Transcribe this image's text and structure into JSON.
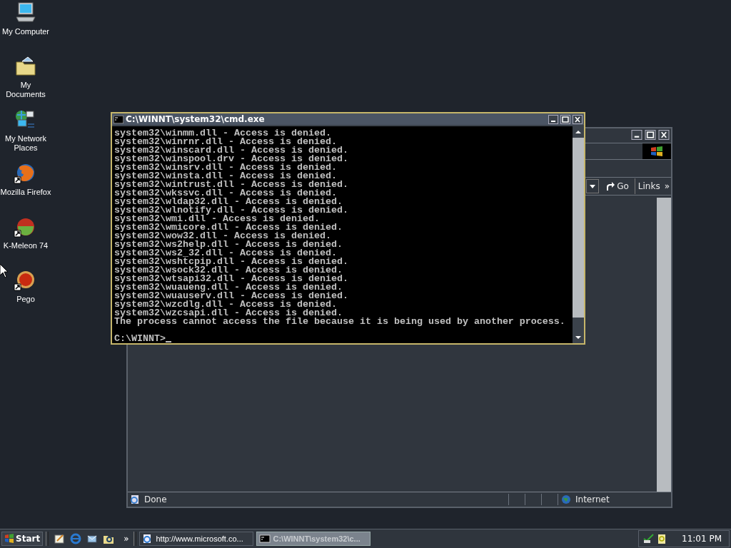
{
  "desktop_icons": [
    {
      "label": "My Computer",
      "kind": "computer",
      "shortcut": false
    },
    {
      "label": "My Documents",
      "kind": "documents",
      "shortcut": false
    },
    {
      "label": "My Network Places",
      "kind": "network",
      "shortcut": false
    },
    {
      "label": "Mozilla Firefox",
      "kind": "firefox",
      "shortcut": true
    },
    {
      "label": "K-Meleon 74",
      "kind": "kmeleon",
      "shortcut": true
    },
    {
      "label": "Pego",
      "kind": "pego",
      "shortcut": true
    }
  ],
  "browser_window": {
    "go": "Go",
    "links": "Links",
    "links_chevron": "»",
    "status": "Done",
    "zone": "Internet"
  },
  "console_window": {
    "title": "C:\\WINNT\\system32\\cmd.exe",
    "lines": [
      "system32\\winmm.dll - Access is denied.",
      "system32\\winrnr.dll - Access is denied.",
      "system32\\winscard.dll - Access is denied.",
      "system32\\winspool.drv - Access is denied.",
      "system32\\winsrv.dll - Access is denied.",
      "system32\\winsta.dll - Access is denied.",
      "system32\\wintrust.dll - Access is denied.",
      "system32\\wkssvc.dll - Access is denied.",
      "system32\\wldap32.dll - Access is denied.",
      "system32\\wlnotify.dll - Access is denied.",
      "system32\\wmi.dll - Access is denied.",
      "system32\\wmicore.dll - Access is denied.",
      "system32\\wow32.dll - Access is denied.",
      "system32\\ws2help.dll - Access is denied.",
      "system32\\ws2_32.dll - Access is denied.",
      "system32\\wshtcpip.dll - Access is denied.",
      "system32\\wsock32.dll - Access is denied.",
      "system32\\wtsapi32.dll - Access is denied.",
      "system32\\wuaueng.dll - Access is denied.",
      "system32\\wuauserv.dll - Access is denied.",
      "system32\\wzcdlg.dll - Access is denied.",
      "system32\\wzcsapi.dll - Access is denied.",
      "The process cannot access the file because it is being used by another process."
    ],
    "prompt": "C:\\WINNT>"
  },
  "taskbar": {
    "start": "Start",
    "quick_launch_chevron": "»",
    "tasks": [
      {
        "label": "http://www.microsoft.co...",
        "kind": "browser",
        "selected": false
      },
      {
        "label": "C:\\WINNT\\system32\\c...",
        "kind": "console",
        "selected": true
      }
    ],
    "clock": "11:01 PM"
  }
}
